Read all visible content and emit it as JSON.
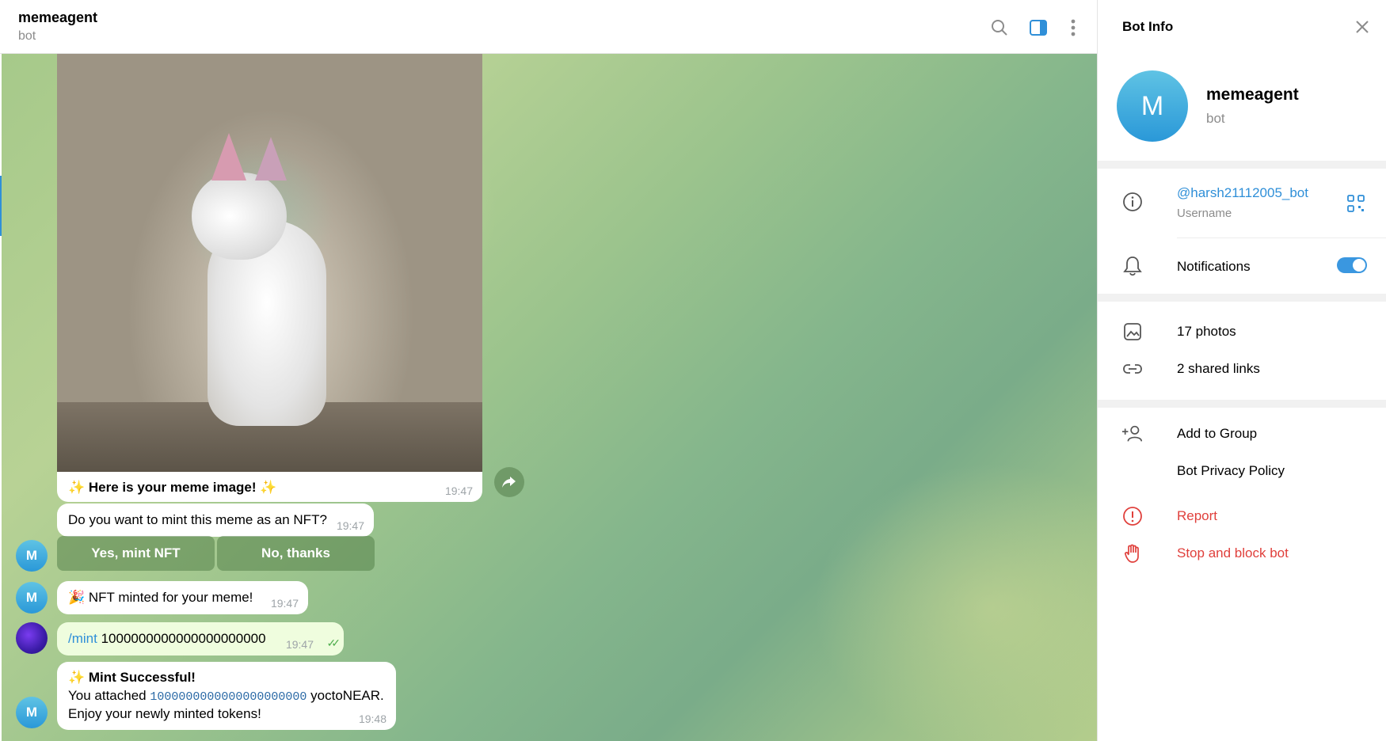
{
  "header": {
    "title": "memeagent",
    "subtitle": "bot",
    "icons": [
      "search-icon",
      "sidebar-toggle-icon",
      "more-vertical-icon"
    ]
  },
  "messages": {
    "photo_caption": "✨ Here is your meme image! ✨",
    "photo_time": "19:47",
    "question": {
      "text": "Do you want to mint this meme as an NFT?",
      "time": "19:47"
    },
    "buttons": {
      "yes": "Yes, mint NFT",
      "no": "No, thanks"
    },
    "minted": {
      "text": "🎉 NFT minted for your meme!",
      "time": "19:47"
    },
    "mint_command": {
      "command": "/mint",
      "amount": "1000000000000000000000",
      "time": "19:47"
    },
    "success": {
      "title": "✨ Mint Successful!",
      "line2_prefix": "You attached",
      "line2_value": "1000000000000000000000",
      "line2_suffix": "yoctoNEAR.",
      "line3": "Enjoy your newly minted tokens!",
      "time": "19:48"
    },
    "bot_avatar_letter": "M"
  },
  "sidebar": {
    "title": "Bot Info",
    "name": "memeagent",
    "subtitle": "bot",
    "avatar_letter": "M",
    "username": "@harsh21112005_bot",
    "username_label": "Username",
    "notifications": "Notifications",
    "notifications_on": true,
    "photos": "17 photos",
    "links": "2 shared links",
    "add_to_group": "Add to Group",
    "privacy": "Bot Privacy Policy",
    "report": "Report",
    "block": "Stop and block bot"
  },
  "colors": {
    "accent": "#2f8fd8",
    "danger": "#e0403c",
    "outgoing_bubble": "#effdde",
    "read_ticks": "#4fae4e"
  }
}
